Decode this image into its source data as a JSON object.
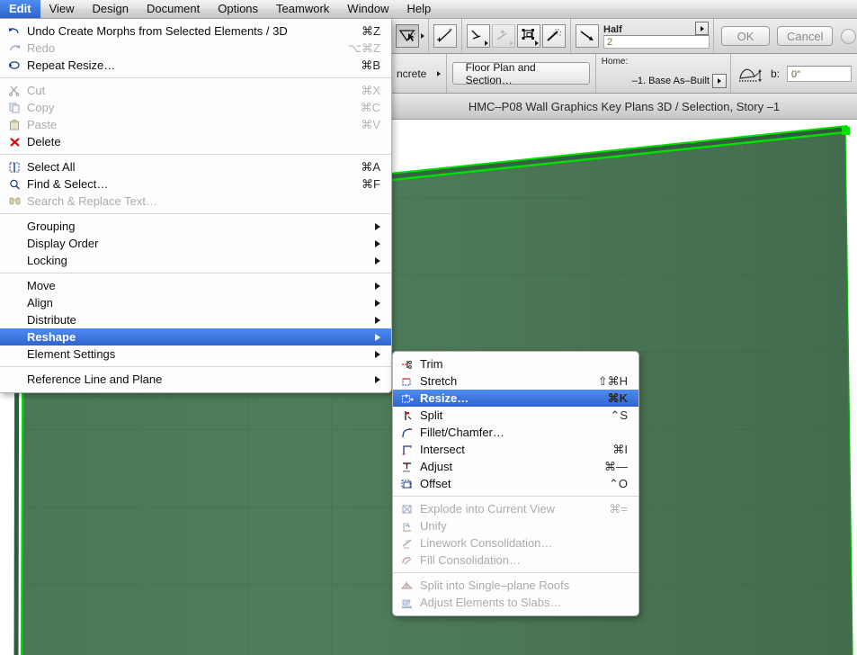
{
  "app": {
    "menubar": [
      {
        "label": "Edit",
        "active": true
      },
      {
        "label": "View",
        "active": false
      },
      {
        "label": "Design",
        "active": false
      },
      {
        "label": "Document",
        "active": false
      },
      {
        "label": "Options",
        "active": false
      },
      {
        "label": "Teamwork",
        "active": false
      },
      {
        "label": "Window",
        "active": false
      },
      {
        "label": "Help",
        "active": false
      }
    ]
  },
  "titlebar": {
    "title": "HMC–P08 Wall Graphics Key Plans 3D / Selection, Story –1"
  },
  "toolbar": {
    "buttons": [
      {
        "name": "arrow-select-tool",
        "state": "pressed",
        "has_arrow": true
      },
      {
        "name": "marquee-line-tool",
        "state": "normal",
        "has_arrow": false
      },
      {
        "name": "rotate-tool",
        "state": "normal",
        "has_arrow": true
      },
      {
        "name": "mirror-tool",
        "state": "disabled",
        "has_arrow": true
      },
      {
        "name": "elevate-tool",
        "state": "normal",
        "has_arrow": true
      },
      {
        "name": "magic-wand-tool",
        "state": "normal",
        "has_arrow": false
      },
      {
        "name": "measure-tool",
        "state": "normal",
        "has_arrow": false
      }
    ],
    "gravity_field": {
      "label": "Half",
      "value": "2"
    },
    "ok_label": "OK",
    "cancel_label": "Cancel",
    "close_label": "✖"
  },
  "infobar": {
    "material_label": "ncrete",
    "floorplan_button": "Floor Plan and Section…",
    "home_label": "Home:",
    "home_story": "–1. Base As–Built",
    "b_label": "b:",
    "b_value": "0\""
  },
  "edit_menu": {
    "groups": [
      {
        "items": [
          {
            "icon": "undo-icon",
            "label": "Undo Create Morphs from Selected Elements / 3D",
            "shortcut": "⌘Z",
            "disabled": false,
            "submenu": false,
            "selected": false
          },
          {
            "icon": "redo-icon",
            "label": "Redo",
            "shortcut": "⌥⌘Z",
            "disabled": true,
            "submenu": false,
            "selected": false
          },
          {
            "icon": "repeat-icon",
            "label": "Repeat Resize…",
            "shortcut": "⌘B",
            "disabled": false,
            "submenu": false,
            "selected": false
          }
        ]
      },
      {
        "items": [
          {
            "icon": "scissors-icon",
            "label": "Cut",
            "shortcut": "⌘X",
            "disabled": true,
            "submenu": false,
            "selected": false
          },
          {
            "icon": "copy-icon",
            "label": "Copy",
            "shortcut": "⌘C",
            "disabled": true,
            "submenu": false,
            "selected": false
          },
          {
            "icon": "paste-icon",
            "label": "Paste",
            "shortcut": "⌘V",
            "disabled": true,
            "submenu": false,
            "selected": false
          },
          {
            "icon": "delete-x-icon",
            "label": "Delete",
            "shortcut": "",
            "disabled": false,
            "submenu": false,
            "selected": false
          }
        ]
      },
      {
        "items": [
          {
            "icon": "select-all-icon",
            "label": "Select All",
            "shortcut": "⌘A",
            "disabled": false,
            "submenu": false,
            "selected": false
          },
          {
            "icon": "find-select-icon",
            "label": "Find & Select…",
            "shortcut": "⌘F",
            "disabled": false,
            "submenu": false,
            "selected": false
          },
          {
            "icon": "binoculars-icon",
            "label": "Search & Replace Text…",
            "shortcut": "",
            "disabled": true,
            "submenu": false,
            "selected": false
          }
        ]
      },
      {
        "items": [
          {
            "icon": "",
            "label": "Grouping",
            "shortcut": "",
            "disabled": false,
            "submenu": true,
            "selected": false
          },
          {
            "icon": "",
            "label": "Display Order",
            "shortcut": "",
            "disabled": false,
            "submenu": true,
            "selected": false
          },
          {
            "icon": "",
            "label": "Locking",
            "shortcut": "",
            "disabled": false,
            "submenu": true,
            "selected": false
          }
        ]
      },
      {
        "items": [
          {
            "icon": "",
            "label": "Move",
            "shortcut": "",
            "disabled": false,
            "submenu": true,
            "selected": false
          },
          {
            "icon": "",
            "label": "Align",
            "shortcut": "",
            "disabled": false,
            "submenu": true,
            "selected": false
          },
          {
            "icon": "",
            "label": "Distribute",
            "shortcut": "",
            "disabled": false,
            "submenu": true,
            "selected": false
          },
          {
            "icon": "",
            "label": "Reshape",
            "shortcut": "",
            "disabled": false,
            "submenu": true,
            "selected": true
          },
          {
            "icon": "",
            "label": "Element Settings",
            "shortcut": "",
            "disabled": false,
            "submenu": true,
            "selected": false
          }
        ]
      },
      {
        "items": [
          {
            "icon": "",
            "label": "Reference Line and Plane",
            "shortcut": "",
            "disabled": false,
            "submenu": true,
            "selected": false
          }
        ]
      }
    ]
  },
  "reshape_submenu": {
    "groups": [
      {
        "items": [
          {
            "icon": "trim-icon",
            "label": "Trim",
            "shortcut": "",
            "disabled": false,
            "selected": false
          },
          {
            "icon": "stretch-icon",
            "label": "Stretch",
            "shortcut": "⇧⌘H",
            "disabled": false,
            "selected": false
          },
          {
            "icon": "resize-icon",
            "label": "Resize…",
            "shortcut": "⌘K",
            "disabled": false,
            "selected": true
          },
          {
            "icon": "split-icon",
            "label": "Split",
            "shortcut": "⌃S",
            "disabled": false,
            "selected": false
          },
          {
            "icon": "fillet-icon",
            "label": "Fillet/Chamfer…",
            "shortcut": "",
            "disabled": false,
            "selected": false
          },
          {
            "icon": "intersect-icon",
            "label": "Intersect",
            "shortcut": "⌘I",
            "disabled": false,
            "selected": false
          },
          {
            "icon": "adjust-icon",
            "label": "Adjust",
            "shortcut": "⌘—",
            "disabled": false,
            "selected": false
          },
          {
            "icon": "offset-icon",
            "label": "Offset",
            "shortcut": "⌃O",
            "disabled": false,
            "selected": false
          }
        ]
      },
      {
        "items": [
          {
            "icon": "explode-icon",
            "label": "Explode into Current View",
            "shortcut": "⌘=",
            "disabled": true,
            "selected": false
          },
          {
            "icon": "unify-icon",
            "label": "Unify",
            "shortcut": "",
            "disabled": true,
            "selected": false
          },
          {
            "icon": "linework-icon",
            "label": "Linework Consolidation…",
            "shortcut": "",
            "disabled": true,
            "selected": false
          },
          {
            "icon": "fill-consolidation-icon",
            "label": "Fill Consolidation…",
            "shortcut": "",
            "disabled": true,
            "selected": false
          }
        ]
      },
      {
        "items": [
          {
            "icon": "split-roofs-icon",
            "label": "Split into Single–plane Roofs",
            "shortcut": "",
            "disabled": true,
            "selected": false
          },
          {
            "icon": "adjust-slabs-icon",
            "label": "Adjust Elements to Slabs…",
            "shortcut": "",
            "disabled": true,
            "selected": false
          }
        ]
      }
    ]
  },
  "viewport": {
    "element_name": "selected-wall-3d",
    "fill_color": "#4d7a58",
    "edge_color": "#00e000",
    "background": "#ffffff"
  }
}
